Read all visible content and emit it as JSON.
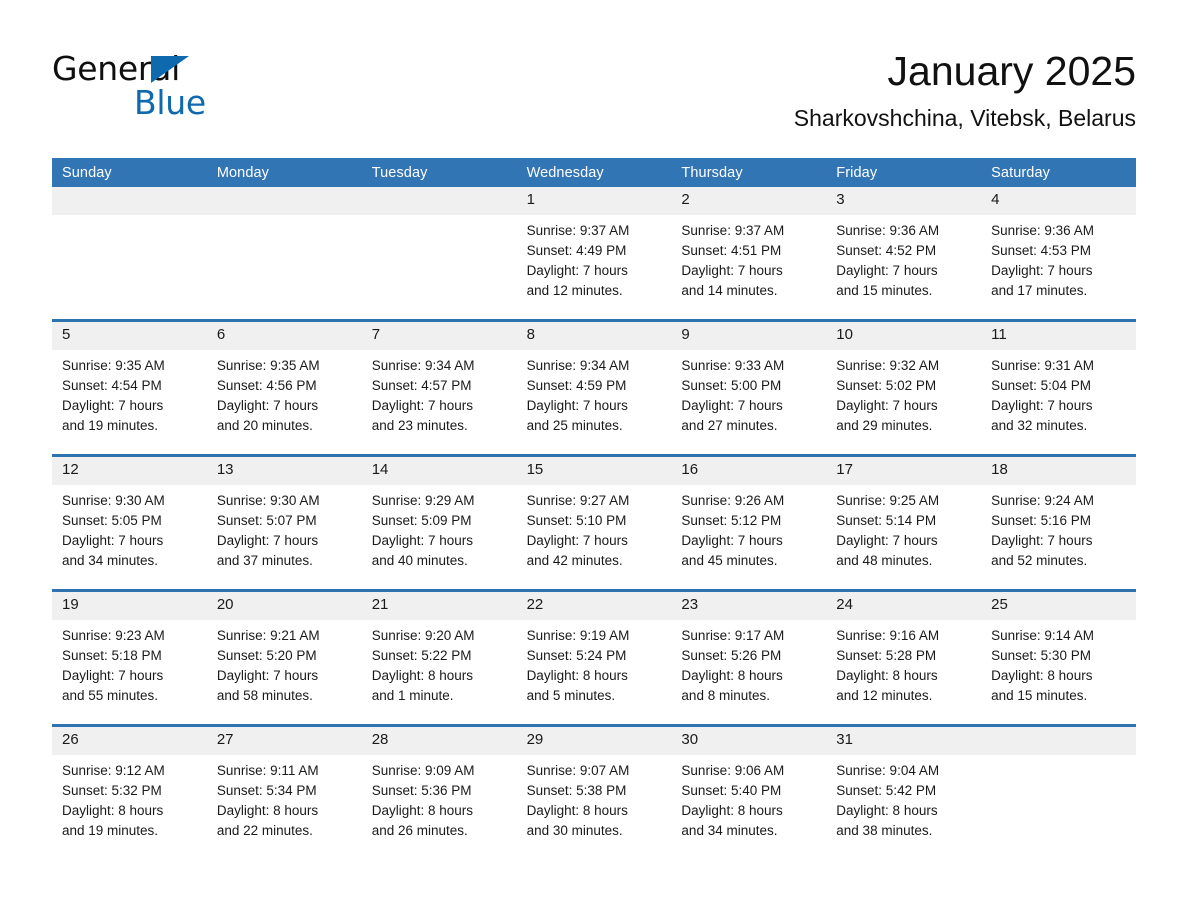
{
  "logo": {
    "word1": "General",
    "word2": "Blue",
    "triangle_color": "#0f69ae"
  },
  "header": {
    "title": "January 2025",
    "location": "Sharkovshchina, Vitebsk, Belarus"
  },
  "theme": {
    "header_blue": "#3275b4",
    "row_divider_blue": "#2e72b0",
    "daynum_band": "#f0f0f0"
  },
  "calendar": {
    "day_names": [
      "Sunday",
      "Monday",
      "Tuesday",
      "Wednesday",
      "Thursday",
      "Friday",
      "Saturday"
    ],
    "weeks": [
      [
        {
          "day": "",
          "sunrise": "",
          "sunset": "",
          "daylight1": "",
          "daylight2": ""
        },
        {
          "day": "",
          "sunrise": "",
          "sunset": "",
          "daylight1": "",
          "daylight2": ""
        },
        {
          "day": "",
          "sunrise": "",
          "sunset": "",
          "daylight1": "",
          "daylight2": ""
        },
        {
          "day": "1",
          "sunrise": "Sunrise: 9:37 AM",
          "sunset": "Sunset: 4:49 PM",
          "daylight1": "Daylight: 7 hours",
          "daylight2": "and 12 minutes."
        },
        {
          "day": "2",
          "sunrise": "Sunrise: 9:37 AM",
          "sunset": "Sunset: 4:51 PM",
          "daylight1": "Daylight: 7 hours",
          "daylight2": "and 14 minutes."
        },
        {
          "day": "3",
          "sunrise": "Sunrise: 9:36 AM",
          "sunset": "Sunset: 4:52 PM",
          "daylight1": "Daylight: 7 hours",
          "daylight2": "and 15 minutes."
        },
        {
          "day": "4",
          "sunrise": "Sunrise: 9:36 AM",
          "sunset": "Sunset: 4:53 PM",
          "daylight1": "Daylight: 7 hours",
          "daylight2": "and 17 minutes."
        }
      ],
      [
        {
          "day": "5",
          "sunrise": "Sunrise: 9:35 AM",
          "sunset": "Sunset: 4:54 PM",
          "daylight1": "Daylight: 7 hours",
          "daylight2": "and 19 minutes."
        },
        {
          "day": "6",
          "sunrise": "Sunrise: 9:35 AM",
          "sunset": "Sunset: 4:56 PM",
          "daylight1": "Daylight: 7 hours",
          "daylight2": "and 20 minutes."
        },
        {
          "day": "7",
          "sunrise": "Sunrise: 9:34 AM",
          "sunset": "Sunset: 4:57 PM",
          "daylight1": "Daylight: 7 hours",
          "daylight2": "and 23 minutes."
        },
        {
          "day": "8",
          "sunrise": "Sunrise: 9:34 AM",
          "sunset": "Sunset: 4:59 PM",
          "daylight1": "Daylight: 7 hours",
          "daylight2": "and 25 minutes."
        },
        {
          "day": "9",
          "sunrise": "Sunrise: 9:33 AM",
          "sunset": "Sunset: 5:00 PM",
          "daylight1": "Daylight: 7 hours",
          "daylight2": "and 27 minutes."
        },
        {
          "day": "10",
          "sunrise": "Sunrise: 9:32 AM",
          "sunset": "Sunset: 5:02 PM",
          "daylight1": "Daylight: 7 hours",
          "daylight2": "and 29 minutes."
        },
        {
          "day": "11",
          "sunrise": "Sunrise: 9:31 AM",
          "sunset": "Sunset: 5:04 PM",
          "daylight1": "Daylight: 7 hours",
          "daylight2": "and 32 minutes."
        }
      ],
      [
        {
          "day": "12",
          "sunrise": "Sunrise: 9:30 AM",
          "sunset": "Sunset: 5:05 PM",
          "daylight1": "Daylight: 7 hours",
          "daylight2": "and 34 minutes."
        },
        {
          "day": "13",
          "sunrise": "Sunrise: 9:30 AM",
          "sunset": "Sunset: 5:07 PM",
          "daylight1": "Daylight: 7 hours",
          "daylight2": "and 37 minutes."
        },
        {
          "day": "14",
          "sunrise": "Sunrise: 9:29 AM",
          "sunset": "Sunset: 5:09 PM",
          "daylight1": "Daylight: 7 hours",
          "daylight2": "and 40 minutes."
        },
        {
          "day": "15",
          "sunrise": "Sunrise: 9:27 AM",
          "sunset": "Sunset: 5:10 PM",
          "daylight1": "Daylight: 7 hours",
          "daylight2": "and 42 minutes."
        },
        {
          "day": "16",
          "sunrise": "Sunrise: 9:26 AM",
          "sunset": "Sunset: 5:12 PM",
          "daylight1": "Daylight: 7 hours",
          "daylight2": "and 45 minutes."
        },
        {
          "day": "17",
          "sunrise": "Sunrise: 9:25 AM",
          "sunset": "Sunset: 5:14 PM",
          "daylight1": "Daylight: 7 hours",
          "daylight2": "and 48 minutes."
        },
        {
          "day": "18",
          "sunrise": "Sunrise: 9:24 AM",
          "sunset": "Sunset: 5:16 PM",
          "daylight1": "Daylight: 7 hours",
          "daylight2": "and 52 minutes."
        }
      ],
      [
        {
          "day": "19",
          "sunrise": "Sunrise: 9:23 AM",
          "sunset": "Sunset: 5:18 PM",
          "daylight1": "Daylight: 7 hours",
          "daylight2": "and 55 minutes."
        },
        {
          "day": "20",
          "sunrise": "Sunrise: 9:21 AM",
          "sunset": "Sunset: 5:20 PM",
          "daylight1": "Daylight: 7 hours",
          "daylight2": "and 58 minutes."
        },
        {
          "day": "21",
          "sunrise": "Sunrise: 9:20 AM",
          "sunset": "Sunset: 5:22 PM",
          "daylight1": "Daylight: 8 hours",
          "daylight2": "and 1 minute."
        },
        {
          "day": "22",
          "sunrise": "Sunrise: 9:19 AM",
          "sunset": "Sunset: 5:24 PM",
          "daylight1": "Daylight: 8 hours",
          "daylight2": "and 5 minutes."
        },
        {
          "day": "23",
          "sunrise": "Sunrise: 9:17 AM",
          "sunset": "Sunset: 5:26 PM",
          "daylight1": "Daylight: 8 hours",
          "daylight2": "and 8 minutes."
        },
        {
          "day": "24",
          "sunrise": "Sunrise: 9:16 AM",
          "sunset": "Sunset: 5:28 PM",
          "daylight1": "Daylight: 8 hours",
          "daylight2": "and 12 minutes."
        },
        {
          "day": "25",
          "sunrise": "Sunrise: 9:14 AM",
          "sunset": "Sunset: 5:30 PM",
          "daylight1": "Daylight: 8 hours",
          "daylight2": "and 15 minutes."
        }
      ],
      [
        {
          "day": "26",
          "sunrise": "Sunrise: 9:12 AM",
          "sunset": "Sunset: 5:32 PM",
          "daylight1": "Daylight: 8 hours",
          "daylight2": "and 19 minutes."
        },
        {
          "day": "27",
          "sunrise": "Sunrise: 9:11 AM",
          "sunset": "Sunset: 5:34 PM",
          "daylight1": "Daylight: 8 hours",
          "daylight2": "and 22 minutes."
        },
        {
          "day": "28",
          "sunrise": "Sunrise: 9:09 AM",
          "sunset": "Sunset: 5:36 PM",
          "daylight1": "Daylight: 8 hours",
          "daylight2": "and 26 minutes."
        },
        {
          "day": "29",
          "sunrise": "Sunrise: 9:07 AM",
          "sunset": "Sunset: 5:38 PM",
          "daylight1": "Daylight: 8 hours",
          "daylight2": "and 30 minutes."
        },
        {
          "day": "30",
          "sunrise": "Sunrise: 9:06 AM",
          "sunset": "Sunset: 5:40 PM",
          "daylight1": "Daylight: 8 hours",
          "daylight2": "and 34 minutes."
        },
        {
          "day": "31",
          "sunrise": "Sunrise: 9:04 AM",
          "sunset": "Sunset: 5:42 PM",
          "daylight1": "Daylight: 8 hours",
          "daylight2": "and 38 minutes."
        },
        {
          "day": "",
          "sunrise": "",
          "sunset": "",
          "daylight1": "",
          "daylight2": ""
        }
      ]
    ]
  }
}
